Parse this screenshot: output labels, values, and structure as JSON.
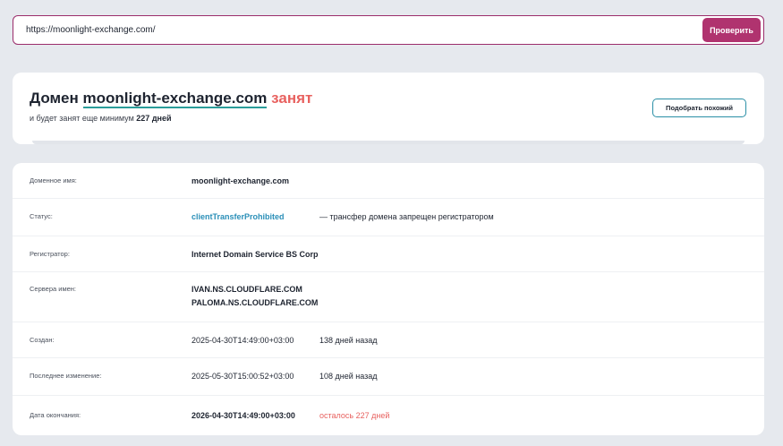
{
  "search": {
    "value": "https://moonlight-exchange.com/",
    "button_label": "Проверить"
  },
  "summary": {
    "prefix": "Домен",
    "domain": "moonlight-exchange.com",
    "status_word": "занят",
    "sub_prefix": "и будет занят еще минимум",
    "sub_days": "227 дней",
    "similar_button_label": "Подобрать похожий"
  },
  "details": {
    "domain_label": "Доменное имя:",
    "domain_value": "moonlight-exchange.com",
    "status_label": "Статус:",
    "status_value": "clientTransferProhibited",
    "status_note": "— трансфер домена запрещен регистратором",
    "registrar_label": "Регистратор:",
    "registrar_value": "Internet Domain Service BS Corp",
    "ns_label": "Сервера имен:",
    "ns_values": [
      "IVAN.NS.CLOUDFLARE.COM",
      "PALOMA.NS.CLOUDFLARE.COM"
    ],
    "created_label": "Создан:",
    "created_value": "2025-04-30T14:49:00+03:00",
    "created_ago": "138 дней назад",
    "updated_label": "Последнее изменение:",
    "updated_value": "2025-05-30T15:00:52+03:00",
    "updated_ago": "108 дней назад",
    "expires_label": "Дата окончания:",
    "expires_value": "2026-04-30T14:49:00+03:00",
    "expires_left": "осталось 227 дней"
  },
  "colors": {
    "accent": "#b0336f",
    "taken": "#e8615f",
    "link": "#2a8fb8"
  }
}
